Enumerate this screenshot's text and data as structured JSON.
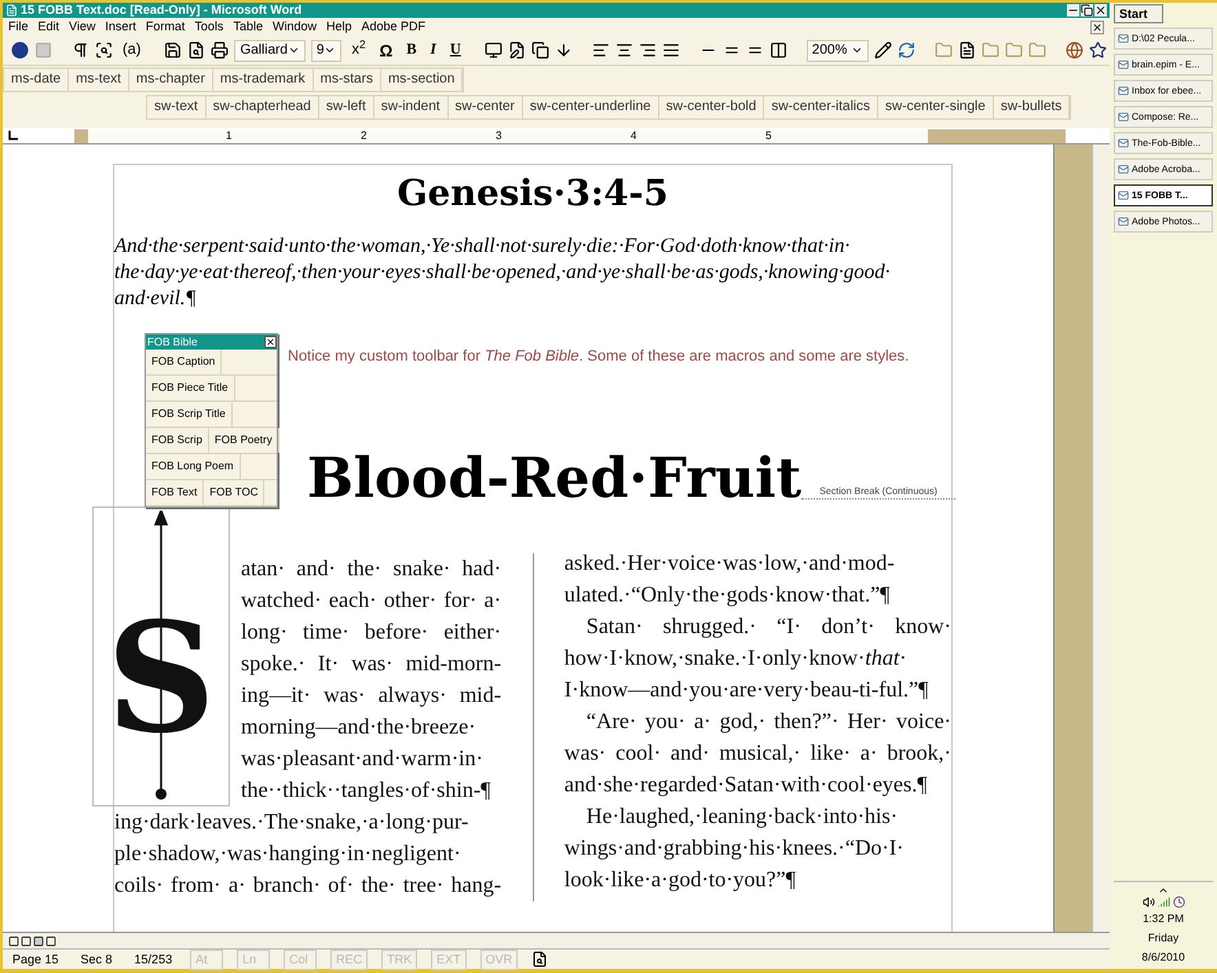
{
  "window": {
    "title": "15 FOBB Text.doc [Read-Only] - Microsoft Word"
  },
  "menu": [
    "File",
    "Edit",
    "View",
    "Insert",
    "Format",
    "Tools",
    "Table",
    "Window",
    "Help",
    "Adobe PDF"
  ],
  "toolbar": {
    "style_button": "(a)",
    "font": "Galliard",
    "size": "9",
    "superscript": "x$^{2}$",
    "symbol": "Ω",
    "bold": "B",
    "italic": "I",
    "underline": "U",
    "zoom": "200%"
  },
  "macro_bar": [
    "ms-date",
    "ms-text",
    "ms-chapter",
    "ms-trademark",
    "ms-stars",
    "ms-section"
  ],
  "style_bar": [
    "sw-text",
    "sw-chapterhead",
    "sw-left",
    "sw-indent",
    "sw-center",
    "sw-center-underline",
    "sw-center-bold",
    "sw-center-italics",
    "sw-center-single",
    "sw-bullets"
  ],
  "ruler": [
    "1",
    "2",
    "3",
    "4",
    "5"
  ],
  "document": {
    "heading": "Genesis·3:4-5",
    "verse_lines": [
      "And·the·serpent·said·unto·the·woman,·Ye·shall·not·surely·die:·For·God·doth·know·that·in·",
      "the·day·ye·eat·thereof,·then·your·eyes·shall·be·opened,·and·ye·shall·be·as·gods,·knowing·good·",
      "and·evil.¶"
    ],
    "note": "Notice my custom toolbar for *The Fob Bible*. Some of these are macros and some are styles.",
    "title": "Blood-Red·Fruit",
    "section_break": "Section Break (Continuous)",
    "drop_cap": "S",
    "left_column": [
      {
        "text": "atan· and· the· snake· had·",
        "wide": false
      },
      {
        "text": "watched· each· other· for· a·",
        "wide": false
      },
      {
        "text": "long· time· before· either·",
        "wide": false
      },
      {
        "text": "spoke.· It· was· mid-morn-",
        "wide": false
      },
      {
        "text": "ing—it· was· always· mid-",
        "wide": false
      },
      {
        "text": "morning—and·the·breeze·",
        "wide": false
      },
      {
        "text": "was·pleasant·and·warm·in·",
        "wide": false
      },
      {
        "text": "the··thick··tangles·of·shin-¶",
        "wide": false
      },
      {
        "text": "ing·dark·leaves.·The·snake,·a·long·pur-",
        "wide": true
      },
      {
        "text": "ple·shadow,·was·hanging·in·negligent·",
        "wide": true
      },
      {
        "text": "coils· from· a· branch· of· the· tree· hang-",
        "wide": true
      }
    ],
    "right_column": [
      {
        "text": "asked.·Her·voice·was·low,·and·mod-",
        "indent": false
      },
      {
        "text": "ulated.·“Only·the·gods·know·that.”¶",
        "indent": false
      },
      {
        "text": "Satan· shrugged.· “I· don’t· know·",
        "indent": true
      },
      {
        "text": "how·I·know,·snake.·I·only·know·*that*·",
        "indent": false
      },
      {
        "text": "I·know—and·you·are·very·beau-ti-ful.”¶",
        "indent": false
      },
      {
        "text": "“Are· you· a· god,· then?”· Her· voice·",
        "indent": true
      },
      {
        "text": "was· cool· and· musical,· like· a· brook,·",
        "indent": false
      },
      {
        "text": "and·she·regarded·Satan·with·cool·eyes.¶",
        "indent": false
      },
      {
        "text": "He·laughed,·leaning·back·into·his·",
        "indent": true
      },
      {
        "text": "wings·and·grabbing·his·knees.·“Do·I·",
        "indent": false
      },
      {
        "text": "look·like·a·god·to·you?”¶",
        "indent": false
      }
    ]
  },
  "floating_toolbar": {
    "title": "FOB Bible",
    "rows": [
      [
        "FOB Caption"
      ],
      [
        "FOB Piece Title"
      ],
      [
        "FOB Scrip Title"
      ],
      [
        "FOB Scrip",
        "FOB Poetry"
      ],
      [
        "FOB Long Poem"
      ],
      [
        "FOB Text",
        "FOB TOC"
      ]
    ]
  },
  "status_bar": {
    "page": "Page 15",
    "section": "Sec 8",
    "position": "15/253",
    "indicators": [
      {
        "label": "At",
        "disabled": true
      },
      {
        "label": "Ln",
        "disabled": true
      },
      {
        "label": "Col",
        "disabled": true
      },
      {
        "label": "REC",
        "disabled": true
      },
      {
        "label": "TRK",
        "disabled": true
      },
      {
        "label": "EXT",
        "disabled": true
      },
      {
        "label": "OVR",
        "disabled": true
      }
    ]
  },
  "taskbar": {
    "start": "Start",
    "items": [
      {
        "label": "D:\\02 Pecula...",
        "selected": false
      },
      {
        "label": "brain.epim - E...",
        "selected": false
      },
      {
        "label": "Inbox for ebee...",
        "selected": false
      },
      {
        "label": "Compose: Re...",
        "selected": false
      },
      {
        "label": "The-Fob-Bible...",
        "selected": false
      },
      {
        "label": "Adobe Acroba...",
        "selected": false
      },
      {
        "label": "15 FOBB T...",
        "selected": true
      },
      {
        "label": "Adobe Photos...",
        "selected": false
      }
    ],
    "clock": {
      "time": "1:32 PM",
      "day": "Friday",
      "date": "8/6/2010"
    }
  }
}
